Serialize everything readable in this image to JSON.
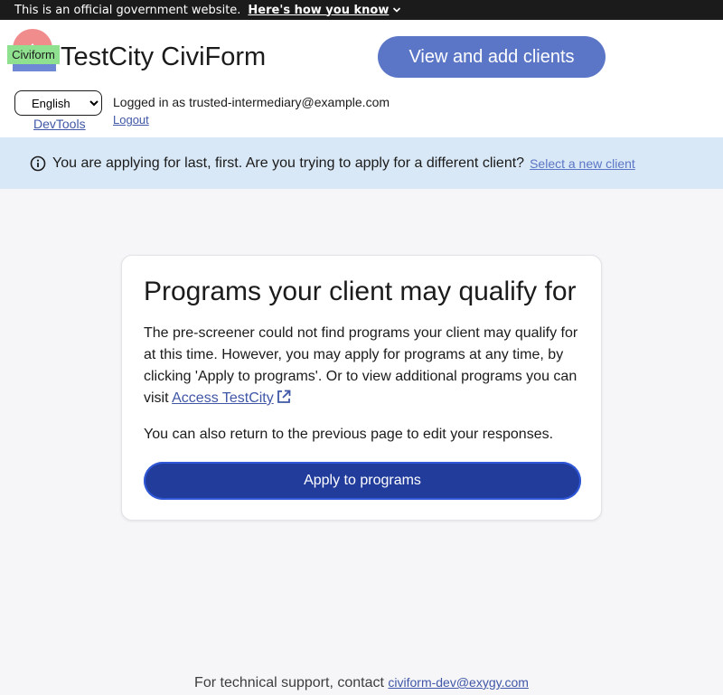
{
  "gov_banner": {
    "text": "This is an official government website.",
    "how_you_know": "Here's how you know",
    "chevron_icon": "chevron-down-icon"
  },
  "header": {
    "logo_text": "Civiform",
    "site_title": "TestCity CiviForm",
    "view_clients_button": "View and add clients",
    "language": {
      "selected": "English",
      "options": [
        "English"
      ]
    },
    "devtools_link": "DevTools",
    "logged_in_text": "Logged in as trusted-intermediary@example.com",
    "logout_link": "Logout"
  },
  "client_alert": {
    "icon": "info-icon",
    "message": "You are applying for last, first. Are you trying to apply for a different client?",
    "select_new_client": "Select a new client"
  },
  "card": {
    "title": "Programs your client may qualify for",
    "description": "The pre-screener could not find programs your client may qualify for at this time. However, you may apply for programs at any time, by clicking 'Apply to programs'. Or to view additional programs you can visit",
    "access_link": "Access TestCity",
    "external_icon": "external-link-icon",
    "edit_text": "You can also return to the previous page to edit your responses.",
    "apply_button": "Apply to programs"
  },
  "footer": {
    "support_text": "For technical support, contact",
    "support_email": "civiform-dev@exygy.com"
  },
  "colors": {
    "banner_bg": "#1b1b1b",
    "header_btn": "#5b76c6",
    "alert_bg": "#d9e8f6",
    "primary_btn": "#223c9c",
    "link": "#3f57a6",
    "page_bg": "#f6f6f9"
  }
}
